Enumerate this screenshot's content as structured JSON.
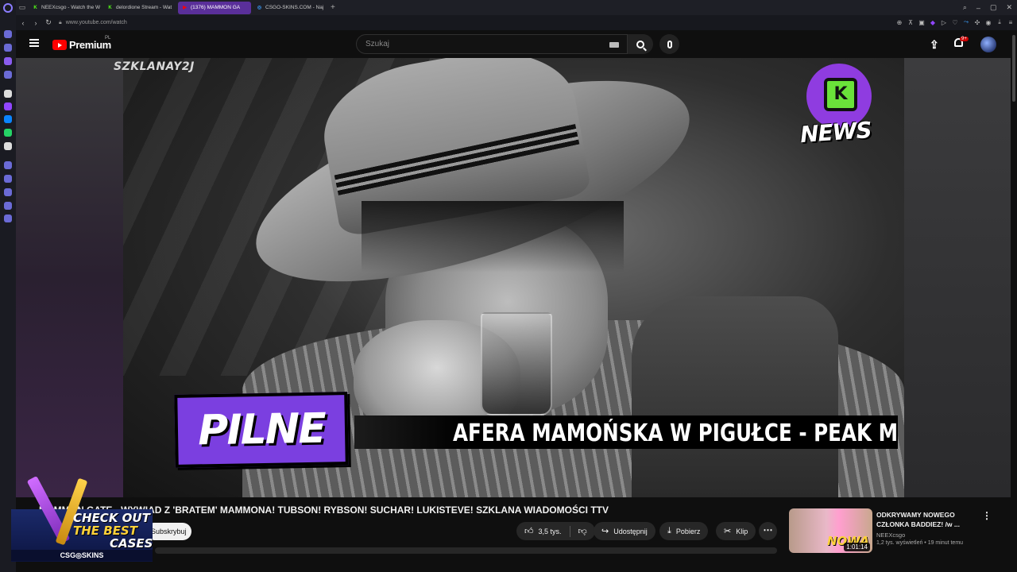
{
  "browser": {
    "tabs": [
      {
        "label": "NEEXcsgo - Watch the W",
        "favicon": "K",
        "favicon_color": "#53fc18",
        "active": false
      },
      {
        "label": "delordione Stream - Wat",
        "favicon": "K",
        "favicon_color": "#53fc18",
        "active": false
      },
      {
        "label": "(1376) MAMMON GA",
        "favicon": "▶",
        "favicon_color": "#ff0000",
        "active": true
      },
      {
        "label": "CSGO-SKINS.COM - Naj",
        "favicon": "◎",
        "favicon_color": "#3aa0ff",
        "active": false
      }
    ],
    "new_tab": "+",
    "url": "www.youtube.com/watch"
  },
  "header": {
    "brand": "Premium",
    "region": "PL",
    "search_placeholder": "Szukaj",
    "notification_count": "9+"
  },
  "video": {
    "watermark": "SZKLANAY2J",
    "news_logo_text": "NEWS",
    "news_logo_glyph": "K",
    "pilne": "PILNE",
    "ticker": "AFERA MAMOŃSKA W PIGUŁCE - PEAK M"
  },
  "below": {
    "title": "MAMMON GATE - WYWIAD Z 'BRATEM' MAMMONA! TUBSON! RYBSON! SUCHAR! LUKISTEVE! SZKLANA WIADOMOŚCI TTV",
    "subscribe": "Subskrybuj",
    "likes": "3,5 tys.",
    "share": "Udostępnij",
    "download": "Pobierz",
    "clip": "Klip"
  },
  "recommendation": {
    "title": "ODKRYWAMY NOWEGO CZŁONKA BADDIEZ! /w ...",
    "channel": "NEEXcsgo",
    "meta": "1,2 tys. wyświetleń • 19 minut temu",
    "duration": "1:01:14",
    "thumb_text": "NOWA"
  },
  "ad": {
    "line1": "CHECK OUT",
    "line2": "THE BEST",
    "line3": "CASES",
    "brand": "CSG◎SKINS"
  },
  "colors": {
    "accent_purple": "#7b3fe0",
    "youtube_red": "#ff0000",
    "kick_green": "#53fc18"
  }
}
